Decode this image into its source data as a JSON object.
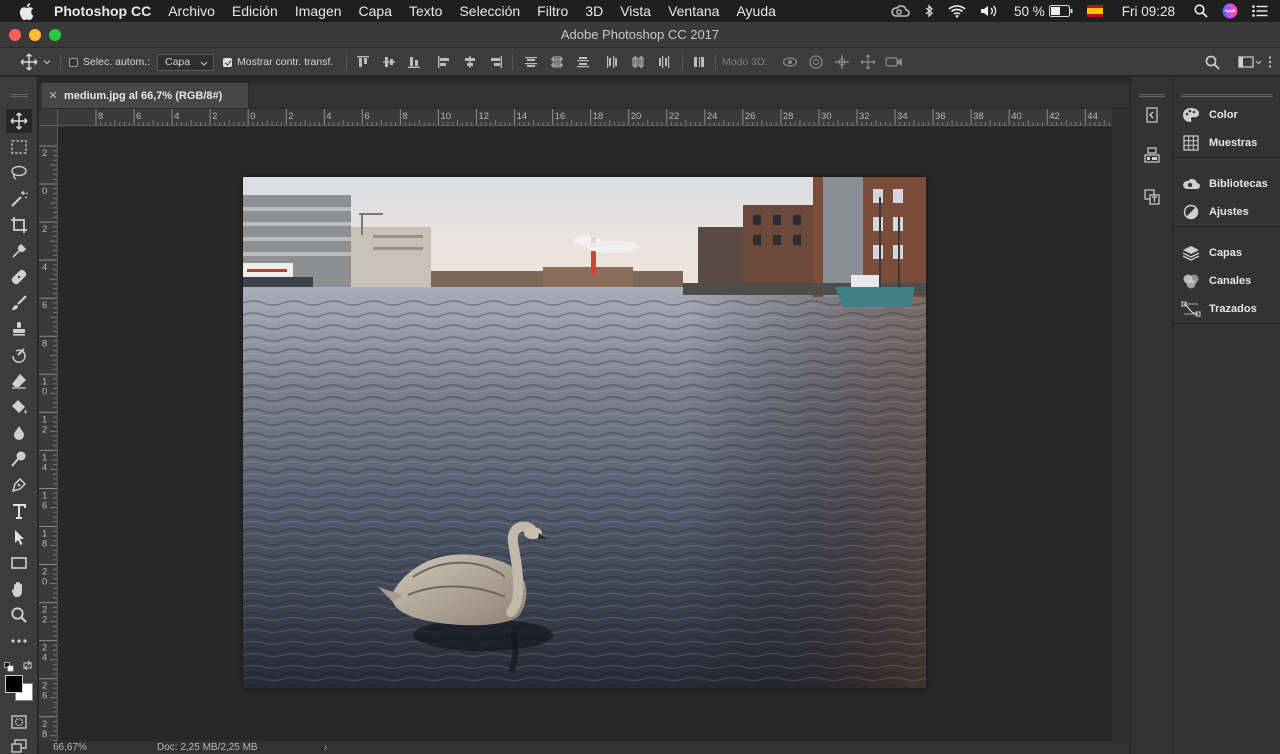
{
  "menubar": {
    "app_name": "Photoshop CC",
    "items": [
      "Archivo",
      "Edición",
      "Imagen",
      "Capa",
      "Texto",
      "Selección",
      "Filtro",
      "3D",
      "Vista",
      "Ventana",
      "Ayuda"
    ],
    "battery": "50 %",
    "clock": "Fri 09:28"
  },
  "window": {
    "title": "Adobe Photoshop CC 2017"
  },
  "options": {
    "auto_select_label": "Selec. autom.:",
    "auto_select_value": "Capa",
    "show_transform_label": "Mostrar contr. transf.",
    "mode3d_label": "Modo 3D:"
  },
  "document": {
    "tab_title": "medium.jpg al 66,7% (RGB/8#)"
  },
  "rulers": {
    "top": [
      "8",
      "6",
      "4",
      "2",
      "0",
      "2",
      "4",
      "6",
      "8",
      "10",
      "12",
      "14",
      "16",
      "18",
      "20",
      "22",
      "24",
      "26",
      "28",
      "30",
      "32",
      "34",
      "36",
      "38",
      "40",
      "42",
      "44"
    ],
    "left": [
      "2",
      "0",
      "2",
      "4",
      "6",
      "8",
      "10",
      "12",
      "14",
      "16",
      "18",
      "20",
      "22",
      "24",
      "26",
      "28"
    ]
  },
  "status": {
    "zoom": "66,67%",
    "doc_info": "Doc: 2,25 MB/2,25 MB"
  },
  "panels": {
    "group1": [
      "Color",
      "Muestras"
    ],
    "group2": [
      "Bibliotecas",
      "Ajustes"
    ],
    "group3": [
      "Capas",
      "Canales",
      "Trazados"
    ]
  },
  "colors": {
    "close": "#fe5f57",
    "minimize": "#febc2e",
    "zoom": "#28c840",
    "boat_hull": "#3f7f86",
    "water": "#4d5566"
  }
}
